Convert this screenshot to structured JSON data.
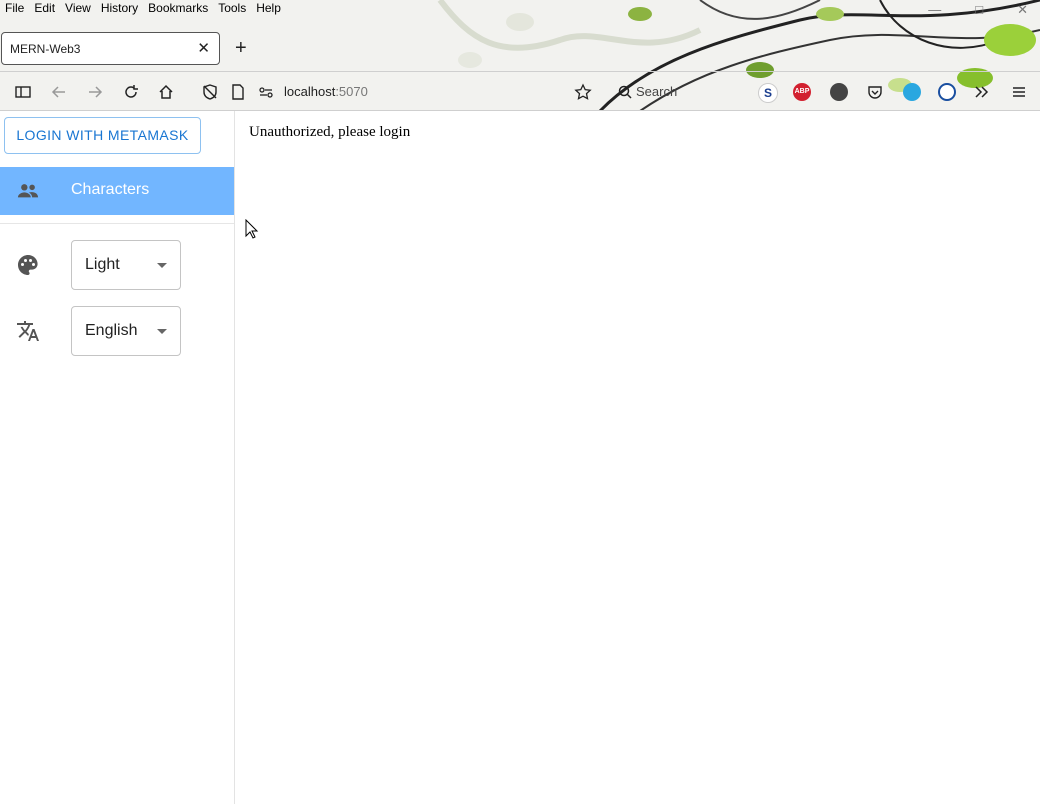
{
  "browser": {
    "menu": [
      "File",
      "Edit",
      "View",
      "History",
      "Bookmarks",
      "Tools",
      "Help"
    ],
    "tab_title": "MERN-Web3",
    "tab_close": "✕",
    "new_tab": "+",
    "url_host": "localhost",
    "url_port": ":5070",
    "search_placeholder": "Search",
    "ext_abp_label": "ABP",
    "ext_s_label": "S"
  },
  "sidebar": {
    "login_label": "LOGIN WITH METAMASK",
    "nav_characters": "Characters",
    "theme_value": "Light",
    "language_value": "English"
  },
  "main": {
    "message": "Unauthorized, please login"
  },
  "colors": {
    "accent": "#1976d2",
    "nav_selected": "#72b6ff"
  }
}
